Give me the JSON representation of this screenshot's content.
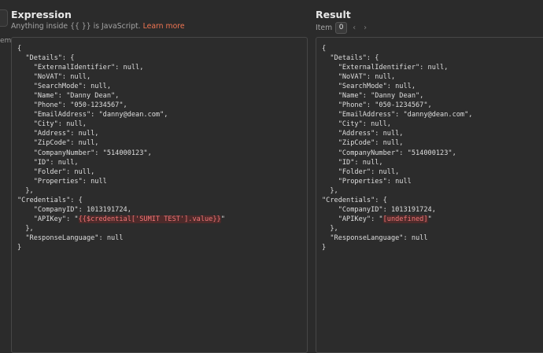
{
  "left_edge": {
    "label": "em"
  },
  "expression_panel": {
    "title": "Expression",
    "hint_prefix": "Anything inside {{ }} is JavaScript.",
    "hint_link": "Learn more",
    "code_before": "{\n  \"Details\": {\n    \"ExternalIdentifier\": null,\n    \"NoVAT\": null,\n    \"SearchMode\": null,\n    \"Name\": \"Danny Dean\",\n    \"Phone\": \"050-1234567\",\n    \"EmailAddress\": \"danny@dean.com\",\n    \"City\": null,\n    \"Address\": null,\n    \"ZipCode\": null,\n    \"CompanyNumber\": \"514000123\",\n    \"ID\": null,\n    \"Folder\": null,\n    \"Properties\": null\n  },\n\"Credentials\": {\n    \"CompanyID\": 1013191724,\n    \"APIKey\": \"",
    "code_highlight": "{{$credential['SUMIT TEST'].value}}",
    "code_after": "\"\n  },\n  \"ResponseLanguage\": null\n}"
  },
  "result_panel": {
    "title": "Result",
    "item_label": "Item",
    "item_index": "0",
    "prev_arrow": "‹",
    "next_arrow": "›",
    "code_before": "{\n  \"Details\": {\n    \"ExternalIdentifier\": null,\n    \"NoVAT\": null,\n    \"SearchMode\": null,\n    \"Name\": \"Danny Dean\",\n    \"Phone\": \"050-1234567\",\n    \"EmailAddress\": \"danny@dean.com\",\n    \"City\": null,\n    \"Address\": null,\n    \"ZipCode\": null,\n    \"CompanyNumber\": \"514000123\",\n    \"ID\": null,\n    \"Folder\": null,\n    \"Properties\": null\n  },\n\"Credentials\": {\n    \"CompanyID\": 1013191724,\n    \"APIKey\": \"",
    "code_highlight": "[undefined]",
    "code_after": "\"\n  },\n  \"ResponseLanguage\": null\n}"
  },
  "colors": {
    "background": "#2b2b2b",
    "error_highlight_bg": "#4d2a2a",
    "error_highlight_text": "#f07575",
    "link": "#f07552"
  }
}
